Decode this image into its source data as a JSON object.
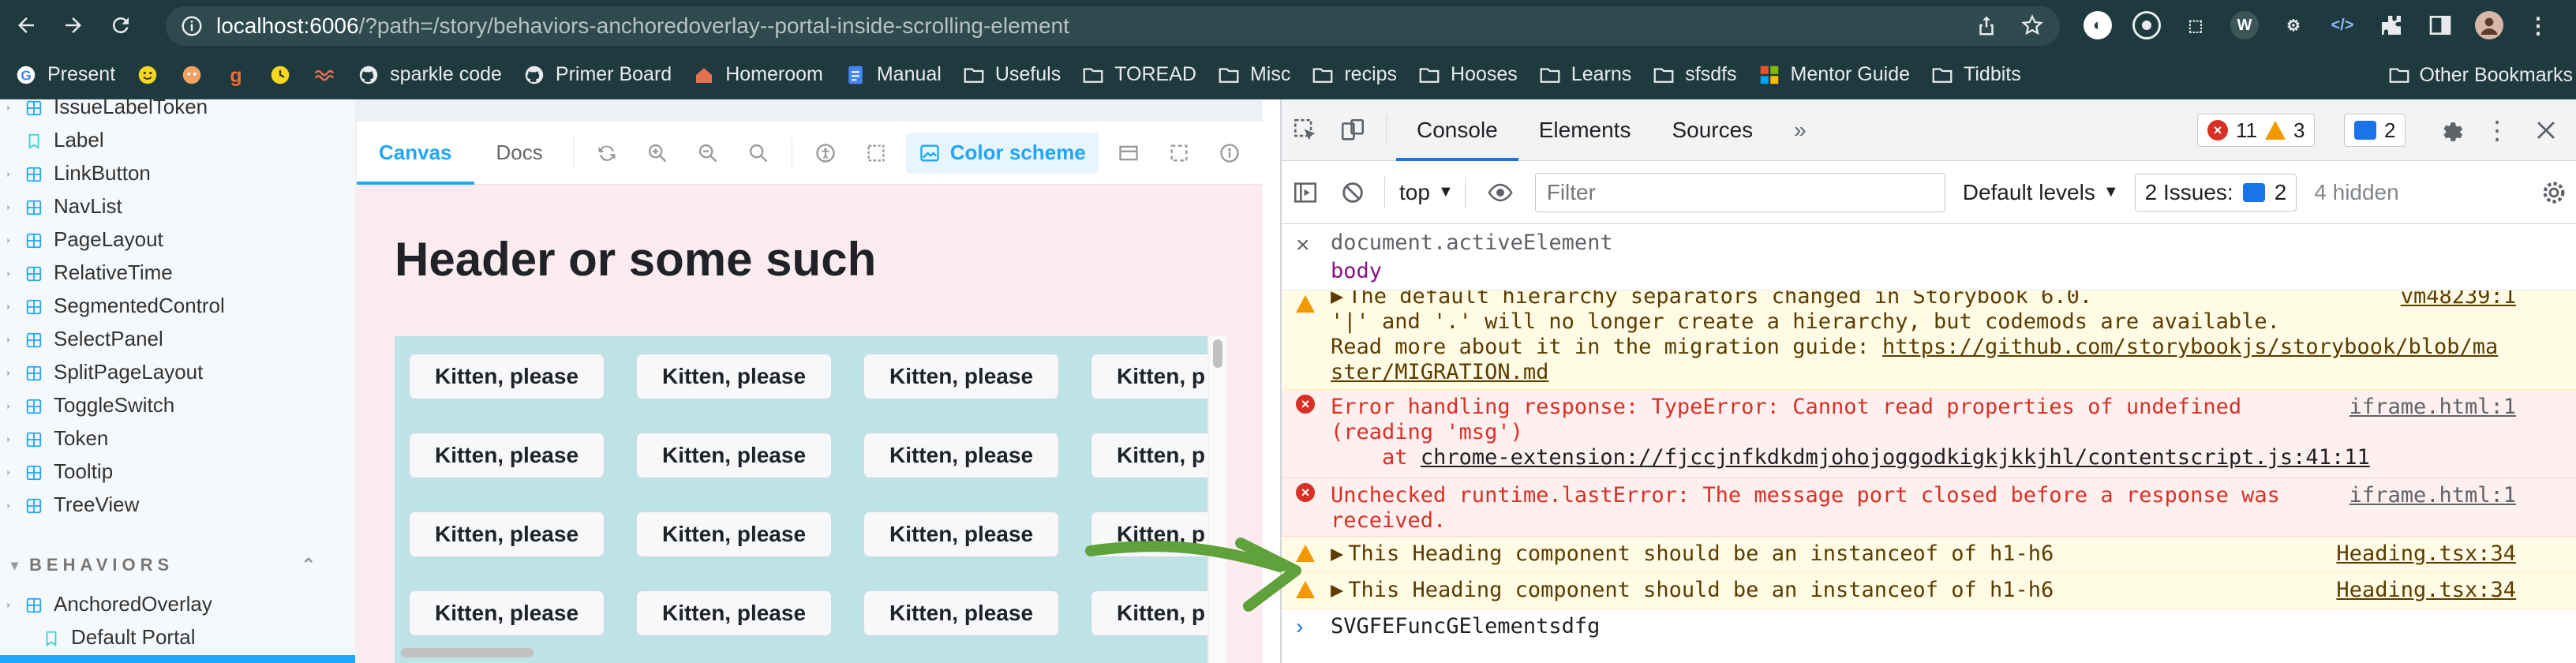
{
  "browser": {
    "url_host": "localhost:6006",
    "url_rest": "/?path=/story/behaviors-anchoredoverlay--portal-inside-scrolling-element",
    "bookmarks": [
      {
        "label": "Present",
        "icon": "google-icon"
      },
      {
        "label": "",
        "icon": "smiley-icon"
      },
      {
        "label": "",
        "icon": "emoji-icon"
      },
      {
        "label": "",
        "icon": "g-icon"
      },
      {
        "label": "",
        "icon": "clock-icon"
      },
      {
        "label": "",
        "icon": "waves-icon"
      },
      {
        "label": "sparkle code",
        "icon": "github-icon"
      },
      {
        "label": "Primer Board",
        "icon": "github-icon"
      },
      {
        "label": "Homeroom",
        "icon": "homeroom-icon"
      },
      {
        "label": "Manual",
        "icon": "doc-icon"
      },
      {
        "label": "Usefuls",
        "icon": "folder-icon"
      },
      {
        "label": "TOREAD",
        "icon": "folder-icon"
      },
      {
        "label": "Misc",
        "icon": "folder-icon"
      },
      {
        "label": "recips",
        "icon": "folder-icon"
      },
      {
        "label": "Hooses",
        "icon": "folder-icon"
      },
      {
        "label": "Learns",
        "icon": "folder-icon"
      },
      {
        "label": "sfsdfs",
        "icon": "folder-icon"
      },
      {
        "label": "Mentor Guide",
        "icon": "microsoft-icon"
      },
      {
        "label": "Tidbits",
        "icon": "folder-icon"
      }
    ],
    "other_bookmarks": "Other Bookmarks"
  },
  "sidebar": {
    "items": [
      {
        "label": "IssueLabelToken",
        "type": "component"
      },
      {
        "label": "Label",
        "type": "doc"
      },
      {
        "label": "LinkButton",
        "type": "component"
      },
      {
        "label": "NavList",
        "type": "component"
      },
      {
        "label": "PageLayout",
        "type": "component"
      },
      {
        "label": "RelativeTime",
        "type": "component"
      },
      {
        "label": "SegmentedControl",
        "type": "component"
      },
      {
        "label": "SelectPanel",
        "type": "component"
      },
      {
        "label": "SplitPageLayout",
        "type": "component"
      },
      {
        "label": "ToggleSwitch",
        "type": "component"
      },
      {
        "label": "Token",
        "type": "component"
      },
      {
        "label": "Tooltip",
        "type": "component"
      },
      {
        "label": "TreeView",
        "type": "component"
      }
    ],
    "section": "BEHAVIORS",
    "section_items": [
      {
        "label": "AnchoredOverlay",
        "type": "component"
      },
      {
        "label": "Default Portal",
        "type": "doc"
      }
    ]
  },
  "preview": {
    "tabs": [
      "Canvas",
      "Docs"
    ],
    "color_scheme_label": "Color scheme",
    "heading": "Header or some such",
    "button_label": "Kitten, please",
    "button_label_clipped": "Kitten, p",
    "accent": "#1ea7fd",
    "canvas_bg": "#fdecef",
    "scroller_bg": "#bde3e6"
  },
  "devtools": {
    "tabs": [
      "Console",
      "Elements",
      "Sources"
    ],
    "errors_count": "11",
    "warnings_count": "3",
    "messages_count": "2",
    "context": "top",
    "filter_placeholder": "Filter",
    "levels": "Default levels",
    "issues_label": "2 Issues:",
    "issues_count": "2",
    "hidden": "4 hidden",
    "live_expression": "document.activeElement",
    "live_value": "body",
    "messages": [
      {
        "level": "warn",
        "text": "The default hierarchy separators changed in Storybook 6.0.",
        "source": "vm48239:1"
      },
      {
        "level": "warn-cont",
        "text": "'|' and '.' will no longer create a hierarchy, but codemods are available."
      },
      {
        "level": "warn-cont",
        "text": "Read more about it in the migration guide: ",
        "link": "https://github.com/storybookjs/storybook/blob/master/MIGRATION.md",
        "link_a": "https://github.com/storybookjs/storybook/blob/ma",
        "link_b": "ster/MIGRATION.md"
      },
      {
        "level": "error",
        "text_a": "Error handling response: TypeError: Cannot read properties of undefined",
        "text_b": "(reading 'msg')",
        "at_prefix": "    at ",
        "at_link": "chrome-extension://fjccjnfkdkdmjohojoggodkigkjkkjhl/contentscript.js:41:11",
        "source": "iframe.html:1"
      },
      {
        "level": "error",
        "text_a": "Unchecked runtime.lastError: The message port closed before a response was",
        "text_b": "received.",
        "source": "iframe.html:1"
      },
      {
        "level": "warn",
        "text": "This Heading component should be an instanceof of h1-h6",
        "source": "Heading.tsx:34"
      },
      {
        "level": "warn",
        "text": "This Heading component should be an instanceof of h1-h6",
        "source": "Heading.tsx:34"
      }
    ],
    "prompt_value": "SVGFEFuncGElementsdfg",
    "colors": {
      "error": "#d93025",
      "warn": "#f29900",
      "info": "#1a73e8"
    }
  }
}
